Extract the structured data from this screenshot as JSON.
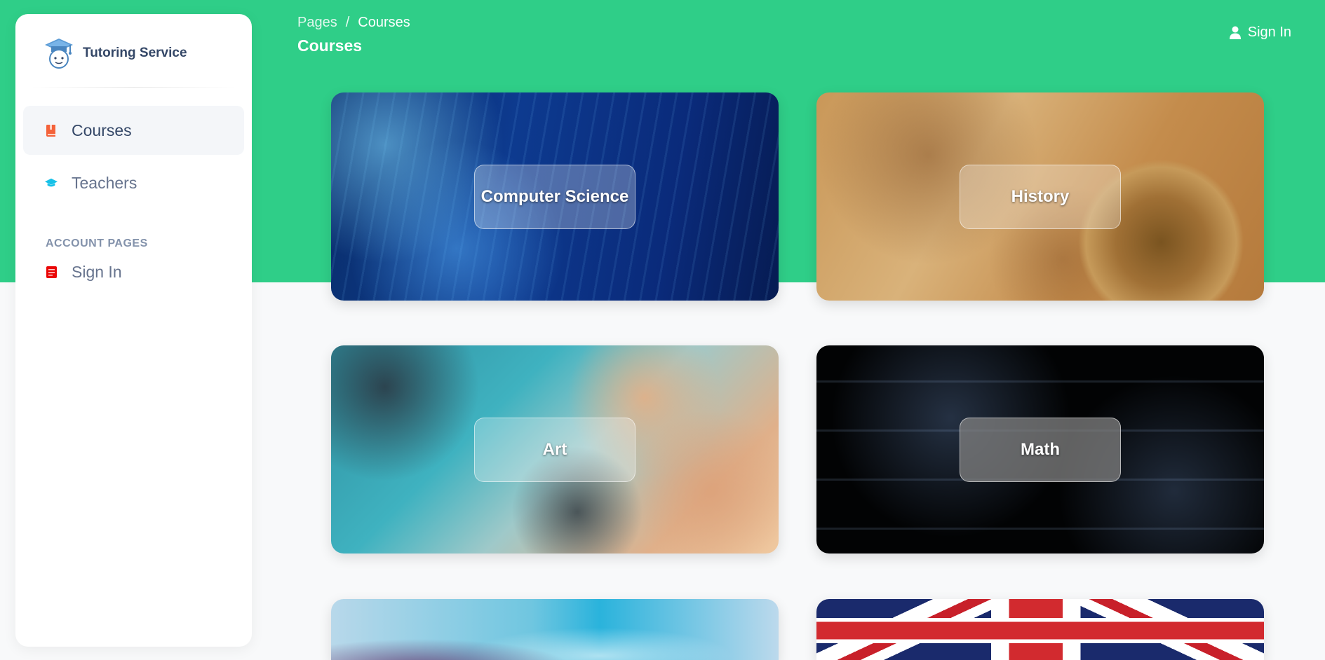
{
  "sidebar": {
    "brand": "Tutoring Service",
    "items": [
      {
        "label": "Courses"
      },
      {
        "label": "Teachers"
      }
    ],
    "section_title": "ACCOUNT PAGES",
    "account_items": [
      {
        "label": "Sign In"
      }
    ]
  },
  "header": {
    "breadcrumb": [
      "Pages",
      "/",
      "Courses"
    ],
    "title": "Courses",
    "signin": "Sign In"
  },
  "courses": [
    {
      "title": "Computer Science"
    },
    {
      "title": "History"
    },
    {
      "title": "Art"
    },
    {
      "title": "Math"
    },
    {
      "title": ""
    },
    {
      "title": ""
    }
  ],
  "colors": {
    "primary": "#2fce88",
    "courses_icon": "#f4623a",
    "teachers_icon": "#17c1e8",
    "signin_icon": "#ea0606"
  },
  "icons": {
    "brand": "graduate-mascot-icon",
    "courses": "book-icon",
    "teachers": "graduation-cap-icon",
    "signin": "document-icon",
    "user": "user-icon"
  }
}
